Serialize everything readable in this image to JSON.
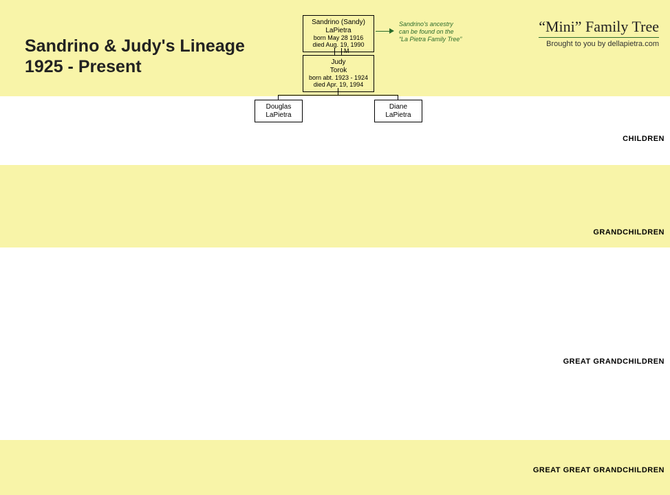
{
  "title_line1": "Sandrino & Judy's Lineage",
  "title_line2": "1925 - Present",
  "brand": {
    "title": "“Mini” Family Tree",
    "subtitle": "Brought to you by dellapietra.com"
  },
  "people": {
    "father": {
      "name": "Sandrino (Sandy)",
      "surname": "LaPietra",
      "born": "born May 28 1916",
      "died": "died Aug. 19, 1990"
    },
    "mother": {
      "name": "Judy",
      "surname": "Torok",
      "born": "born abt. 1923 - 1924",
      "died": "died Apr. 19, 1994"
    },
    "child1": {
      "name": "Douglas",
      "surname": "LaPietra"
    },
    "child2": {
      "name": "Diane",
      "surname": "LaPietra"
    }
  },
  "marriage_label": "M",
  "note": {
    "line1": "Sandrino's ancestry",
    "line2": "can be found on the",
    "line3": "“La Pietra Family Tree”"
  },
  "sections": {
    "children": "CHILDREN",
    "grandchildren": "GRANDCHILDREN",
    "great_grandchildren": "GREAT GRANDCHILDREN",
    "great_great_grandchildren": "GREAT GREAT GRANDCHILDREN"
  }
}
